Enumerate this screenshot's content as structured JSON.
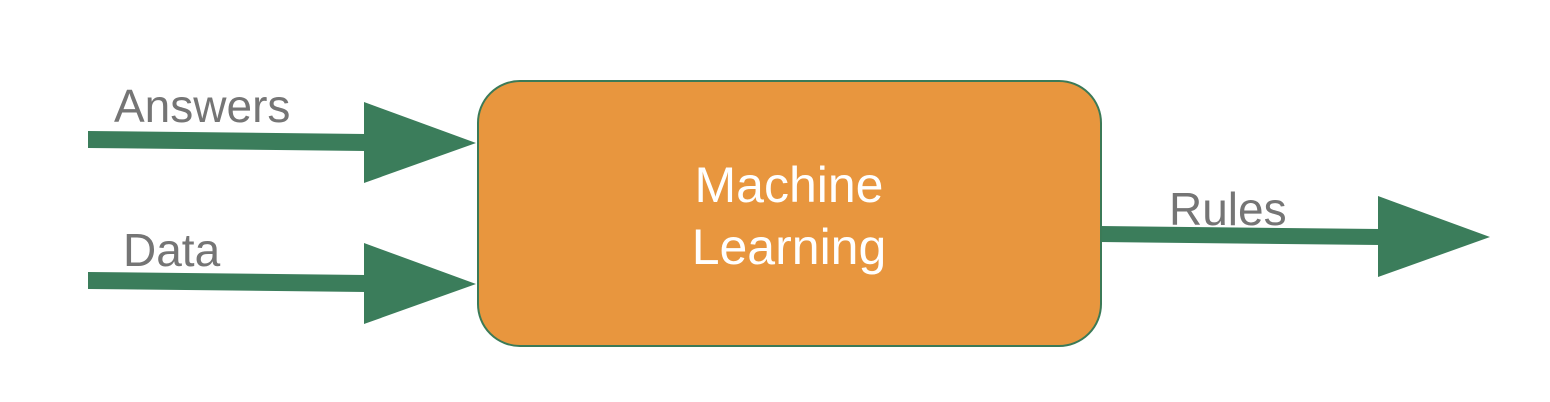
{
  "diagram": {
    "center_box": {
      "line1": "Machine",
      "line2": "Learning",
      "fill_color": "#E8963E",
      "border_color": "#3B7A57"
    },
    "inputs": {
      "answers_label": "Answers",
      "data_label": "Data"
    },
    "output": {
      "rules_label": "Rules"
    },
    "arrow_color": "#3B7D5B",
    "label_color": "#757575"
  }
}
